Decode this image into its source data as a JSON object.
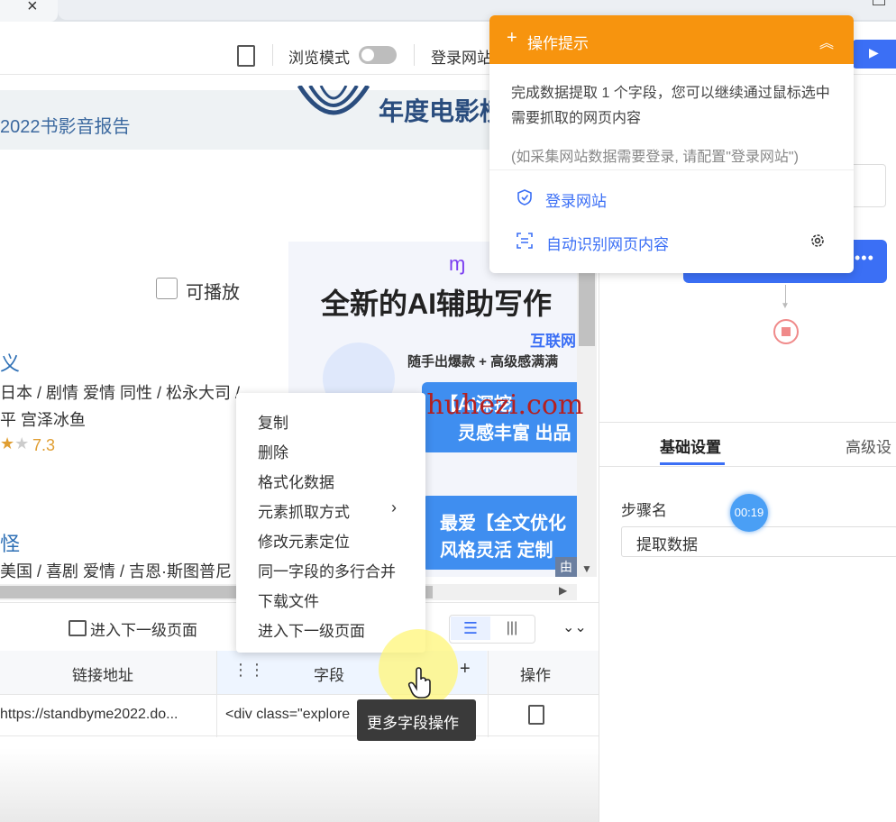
{
  "toolbar": {
    "browse_mode_label": "浏览模式",
    "login_site_label": "登录网站"
  },
  "webpage": {
    "banner_text": "2022书影音报告",
    "banner_title": "年度电影榜",
    "playable_label": "可播放",
    "movie1": {
      "title": "义",
      "line1": "日本 / 剧情 爱情 同性 / 松永大司 /",
      "line2": "平 宫泽冰鱼",
      "score": "7.3"
    },
    "movie2": {
      "title": "怪",
      "line1": "美国 / 喜剧 爱情 / 吉恩·斯图普尼"
    },
    "ad": {
      "headline": "全新的AI辅助写作",
      "sub": "互联网",
      "tagline": "随手出爆款 + 高级感满满",
      "card1_top": "【AI深挖",
      "card1_bottom": "灵感丰富 出品",
      "card2_top": "最爱【全文优化",
      "card2_bottom": "风格灵活 定制",
      "badge": "由"
    },
    "watermark": "songshuhezi.com"
  },
  "data_panel": {
    "next_level_label": "进入下一级页面",
    "columns": [
      "链接地址",
      "字段",
      "操作"
    ],
    "rows": [
      {
        "url": "https://standbyme2022.do...",
        "field": "<div class=\"explore"
      }
    ]
  },
  "context_menu": {
    "items": [
      "复制",
      "删除",
      "格式化数据",
      "元素抓取方式",
      "修改元素定位",
      "同一字段的多行合并",
      "下载文件",
      "进入下一级页面"
    ]
  },
  "tooltip": {
    "text": "更多字段操作"
  },
  "tips": {
    "title": "操作提示",
    "body": "完成数据提取 1 个字段，您可以继续通过鼠标选中需要抓取的网页内容",
    "note": "(如采集网站数据需要登录, 请配置\"登录网站\")",
    "login_link": "登录网站",
    "auto_detect_link": "自动识别网页内容"
  },
  "right_panel": {
    "tab_basic": "基础设置",
    "tab_advanced": "高级设",
    "step_name_label": "步骤名",
    "step_name_value": "提取数据",
    "timer": "00:19"
  },
  "colors": {
    "accent": "#3b6ff5",
    "tips_header": "#f7940e",
    "link": "#2d6fb5"
  }
}
